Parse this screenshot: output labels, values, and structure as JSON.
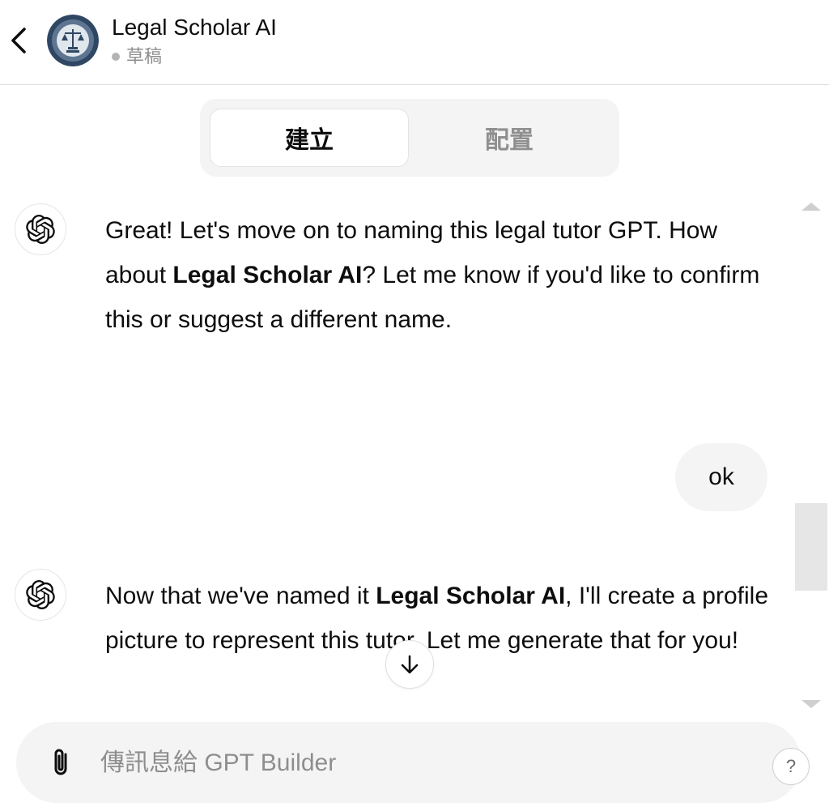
{
  "header": {
    "title": "Legal Scholar AI",
    "status": "草稿",
    "back_icon": "chevron-left-icon",
    "avatar_icon": "legal-scholar-avatar-icon"
  },
  "tabs": [
    {
      "label": "建立",
      "active": true
    },
    {
      "label": "配置",
      "active": false
    }
  ],
  "messages": [
    {
      "role": "assistant",
      "icon": "openai-logo-icon",
      "segments": [
        {
          "text": "Great! Let's move on to naming this legal tutor GPT. How about ",
          "bold": false
        },
        {
          "text": "Legal Scholar AI",
          "bold": true
        },
        {
          "text": "? Let me know if you'd like to confirm this or suggest a different name.",
          "bold": false
        }
      ]
    },
    {
      "role": "user",
      "text": "ok"
    },
    {
      "role": "assistant",
      "icon": "openai-logo-icon",
      "segments": [
        {
          "text": "Now that we've named it ",
          "bold": false
        },
        {
          "text": "Legal Scholar AI",
          "bold": true
        },
        {
          "text": ", I'll create a profile picture to represent this tutor. Let me generate that for you!",
          "bold": false
        }
      ]
    }
  ],
  "composer": {
    "placeholder": "傳訊息給 GPT Builder",
    "value": "",
    "attach_icon": "paperclip-icon"
  },
  "help": {
    "label": "?"
  },
  "colors": {
    "background": "#ffffff",
    "bubble": "#f4f4f4",
    "text": "#0d0d0d",
    "muted": "#8e8e8e"
  }
}
